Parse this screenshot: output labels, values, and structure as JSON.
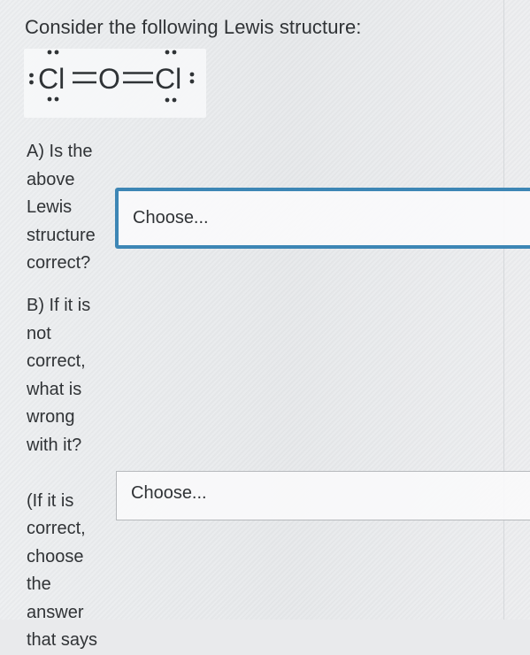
{
  "prompt": "Consider the following Lewis structure:",
  "lewis_structure": {
    "atoms": [
      "Cl",
      "O",
      "Cl"
    ],
    "bonds": [
      "double",
      "double"
    ]
  },
  "question_a": {
    "lines": [
      "A) Is the",
      "above",
      "Lewis",
      "structure",
      "correct?"
    ]
  },
  "question_b": {
    "lines": [
      "B) If it is",
      "not",
      "correct,",
      "what is",
      "wrong",
      "with it?",
      "",
      "(If it is",
      "correct,",
      "choose",
      "the",
      "answer",
      "that says"
    ]
  },
  "select_a": {
    "value": "Choose..."
  },
  "select_b": {
    "value": "Choose..."
  },
  "colors": {
    "focus_border": "#3d86b5",
    "text": "#303336",
    "background": "#e9eaec"
  }
}
